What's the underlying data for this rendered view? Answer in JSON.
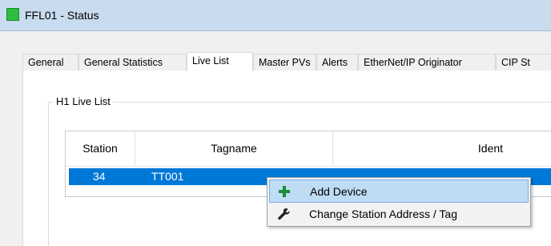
{
  "window": {
    "title": "FFL01 - Status",
    "icon": "green-square-icon"
  },
  "tabs": [
    {
      "label": "General"
    },
    {
      "label": "General Statistics"
    },
    {
      "label": "Live List",
      "active": true
    },
    {
      "label": "Master PVs"
    },
    {
      "label": "Alerts"
    },
    {
      "label": "EtherNet/IP Originator"
    },
    {
      "label": "CIP St"
    }
  ],
  "group": {
    "title": "H1 Live List"
  },
  "table": {
    "columns": [
      "Station",
      "Tagname",
      "Ident"
    ],
    "rows": [
      {
        "station": "34",
        "tagname": "TT001",
        "ident": ""
      }
    ]
  },
  "context_menu": {
    "items": [
      {
        "label": "Add Device",
        "icon": "plus-icon",
        "highlighted": true
      },
      {
        "label": "Change Station Address / Tag",
        "icon": "wrench-icon"
      }
    ]
  },
  "colors": {
    "selection": "#0078d7",
    "menu_hover": "#bfdcf5",
    "plus_icon": "#1e8c3a"
  }
}
